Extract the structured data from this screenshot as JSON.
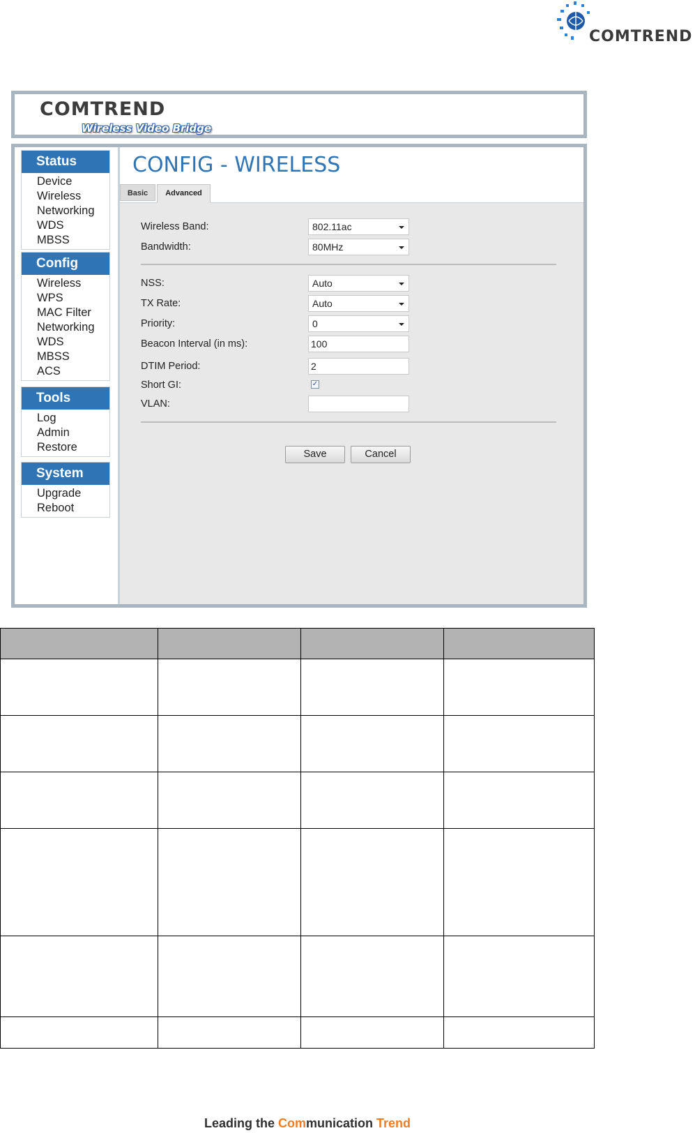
{
  "corporate": {
    "brand": "COMTREND"
  },
  "header": {
    "brand": "COMTREND",
    "subtitle": "Wireless Video Bridge"
  },
  "sidebar": {
    "groups": [
      {
        "title": "Status",
        "items": [
          "Device",
          "Wireless",
          "Networking",
          "WDS",
          "MBSS"
        ]
      },
      {
        "title": "Config",
        "items": [
          "Wireless",
          "WPS",
          "MAC Filter",
          "Networking",
          "WDS",
          "MBSS",
          "ACS"
        ]
      },
      {
        "title": "Tools",
        "items": [
          "Log",
          "Admin",
          "Restore"
        ]
      },
      {
        "title": "System",
        "items": [
          "Upgrade",
          "Reboot"
        ]
      }
    ]
  },
  "page": {
    "title": "CONFIG - WIRELESS",
    "tabs": [
      "Basic",
      "Advanced"
    ],
    "active_tab": "Advanced"
  },
  "form": {
    "wireless_band": {
      "label": "Wireless Band:",
      "value": "802.11ac"
    },
    "bandwidth": {
      "label": "Bandwidth:",
      "value": "80MHz"
    },
    "nss": {
      "label": "NSS:",
      "value": "Auto"
    },
    "tx_rate": {
      "label": "TX Rate:",
      "value": "Auto"
    },
    "priority": {
      "label": "Priority:",
      "value": "0"
    },
    "beacon_interval": {
      "label": "Beacon Interval (in ms):",
      "value": "100"
    },
    "dtim_period": {
      "label": "DTIM Period:",
      "value": "2"
    },
    "short_gi": {
      "label": "Short GI:",
      "checked": true
    },
    "vlan": {
      "label": "VLAN:",
      "value": ""
    }
  },
  "buttons": {
    "save": "Save",
    "cancel": "Cancel"
  },
  "footer": {
    "part1": "Leading the ",
    "accent1": "Com",
    "part2": "munication ",
    "accent2": "Trend"
  },
  "colors": {
    "accent": "#2f75b5",
    "footer_accent": "#f07d22",
    "frame": "#a9b6c2"
  }
}
